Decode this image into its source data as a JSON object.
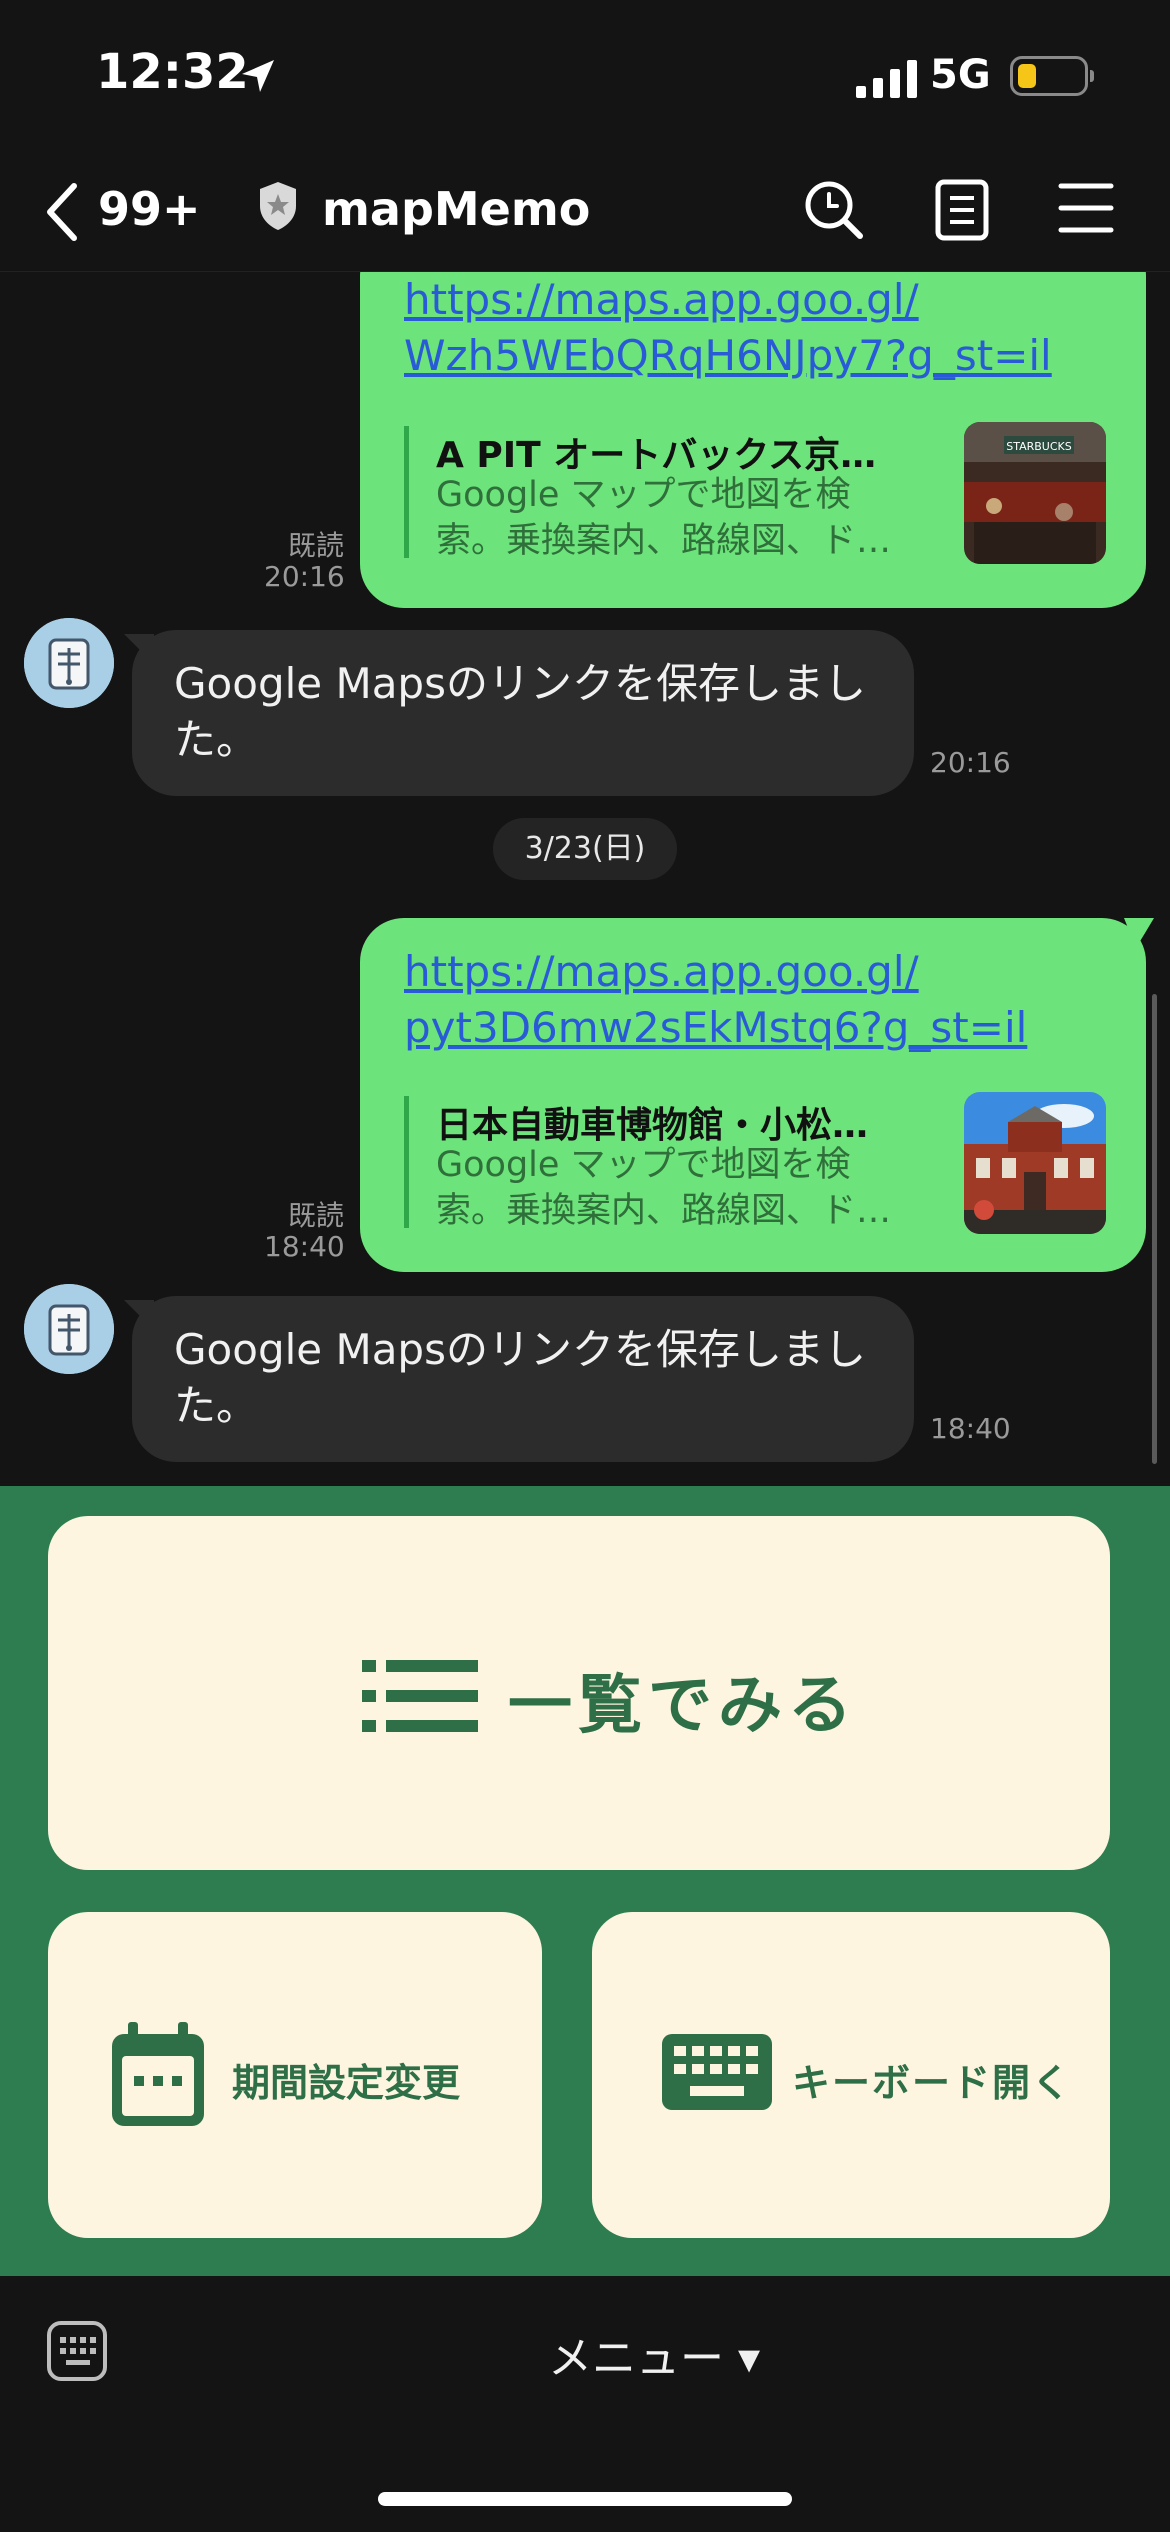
{
  "status_bar": {
    "time": "12:32",
    "network": "5G",
    "battery_color": "#f5c518"
  },
  "nav": {
    "unread": "99+",
    "title": "mapMemo"
  },
  "messages": [
    {
      "link_line1": "https://maps.app.goo.gl/",
      "link_line2": "Wzh5WEbQRqH6NJpy7?g_st=il",
      "preview_title": "A PIT オートバックス京…",
      "preview_desc1": "Google マップで地図を検",
      "preview_desc2": "索。乗換案内、路線図、ド…",
      "read": "既読",
      "time": "20:16"
    },
    {
      "reply": "Google Mapsのリンクを保存しました。",
      "time": "20:16"
    },
    {
      "date": "3/23(日)"
    },
    {
      "link_line1": "https://maps.app.goo.gl/",
      "link_line2": "pyt3D6mw2sEkMstq6?g_st=il",
      "preview_title": "日本自動車博物館・小松…",
      "preview_desc1": "Google マップで地図を検",
      "preview_desc2": "索。乗換案内、路線図、ド…",
      "read": "既読",
      "time": "18:40"
    },
    {
      "reply": "Google Mapsのリンクを保存しました。",
      "time": "18:40"
    }
  ],
  "rich_menu": {
    "list_label": "一覧でみる",
    "period_label": "期間設定変更",
    "keyboard_label": "キーボード開く",
    "background": "#2e7d50",
    "card_color": "#fdf5e0",
    "accent": "#2e6f48"
  },
  "bottom_bar": {
    "menu_label": "メニュー ▾"
  },
  "colors": {
    "outgoing_bubble": "#6ce37b",
    "incoming_bubble": "#2c2c2c",
    "link": "#2a5bd7"
  }
}
